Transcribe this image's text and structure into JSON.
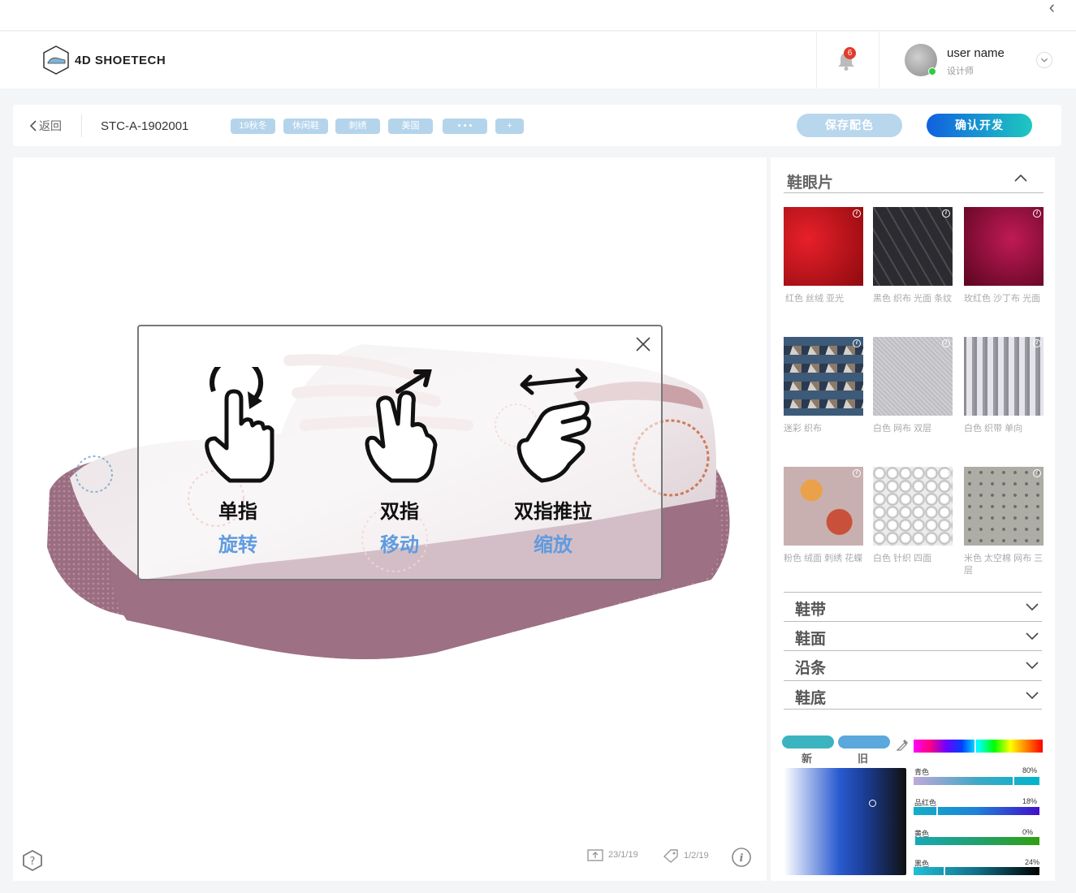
{
  "topbar": {
    "collapse_icon": "chevron-left-icon"
  },
  "header": {
    "logo_text": "4D SHOETECH",
    "notification_count": "6",
    "user_name": "user name",
    "user_role": "设计师"
  },
  "toolbar": {
    "back_label": "返回",
    "code": "STC-A-1902001",
    "tags": [
      "19秋冬",
      "休闲鞋",
      "刺绣",
      "美国",
      "• • •",
      "+"
    ],
    "save_label": "保存配色",
    "confirm_label": "确认开发"
  },
  "gestures": [
    {
      "title": "单指",
      "action": "旋转",
      "icon": "rotate-finger-icon"
    },
    {
      "title": "双指",
      "action": "移动",
      "icon": "two-finger-move-icon"
    },
    {
      "title": "双指推拉",
      "action": "缩放",
      "icon": "pinch-zoom-icon"
    }
  ],
  "viewer_footer": {
    "date_created": "23/1/19",
    "date_tag": "1/2/19"
  },
  "panel": {
    "open_section": "鞋眼片",
    "swatches": [
      {
        "label": "红色  丝绒  亚光",
        "color": "#b30f14"
      },
      {
        "label": "黑色  织布  光面  条纹",
        "color": "#3a3a3e"
      },
      {
        "label": "玫红色  沙丁布  光面",
        "color": "#8c0a35"
      },
      {
        "label": "迷彩  织布",
        "color": "#3d5a78"
      },
      {
        "label": "白色  网布  双层",
        "color": "#c9c9cd"
      },
      {
        "label": "白色  织带  单向",
        "color": "#b6b6bc"
      },
      {
        "label": "粉色  绒面  刺绣  花蝶",
        "color": "#c8a0a0"
      },
      {
        "label": "白色  针织  四面",
        "color": "#ececec"
      },
      {
        "label": "米色  太空棉  网布  三层",
        "color": "#a6a6a0"
      }
    ],
    "collapsed_sections": [
      "鞋带",
      "鞋面",
      "沿条",
      "鞋底"
    ],
    "color_new_label": "新",
    "color_old_label": "旧",
    "new_color": "#3bb4c0",
    "old_color": "#5aa8dc",
    "cmyk": [
      {
        "name": "青色",
        "value": "80%",
        "fraction": 0.8
      },
      {
        "name": "品红色",
        "value": "18%",
        "fraction": 0.18
      },
      {
        "name": "黄色",
        "value": "0%",
        "fraction": 0.0
      },
      {
        "name": "黑色",
        "value": "24%",
        "fraction": 0.24
      }
    ]
  },
  "colors": {
    "accent": "#1160e0",
    "tag_bg": "#b4d4ec",
    "gesture_sub": "#5f9be0"
  }
}
